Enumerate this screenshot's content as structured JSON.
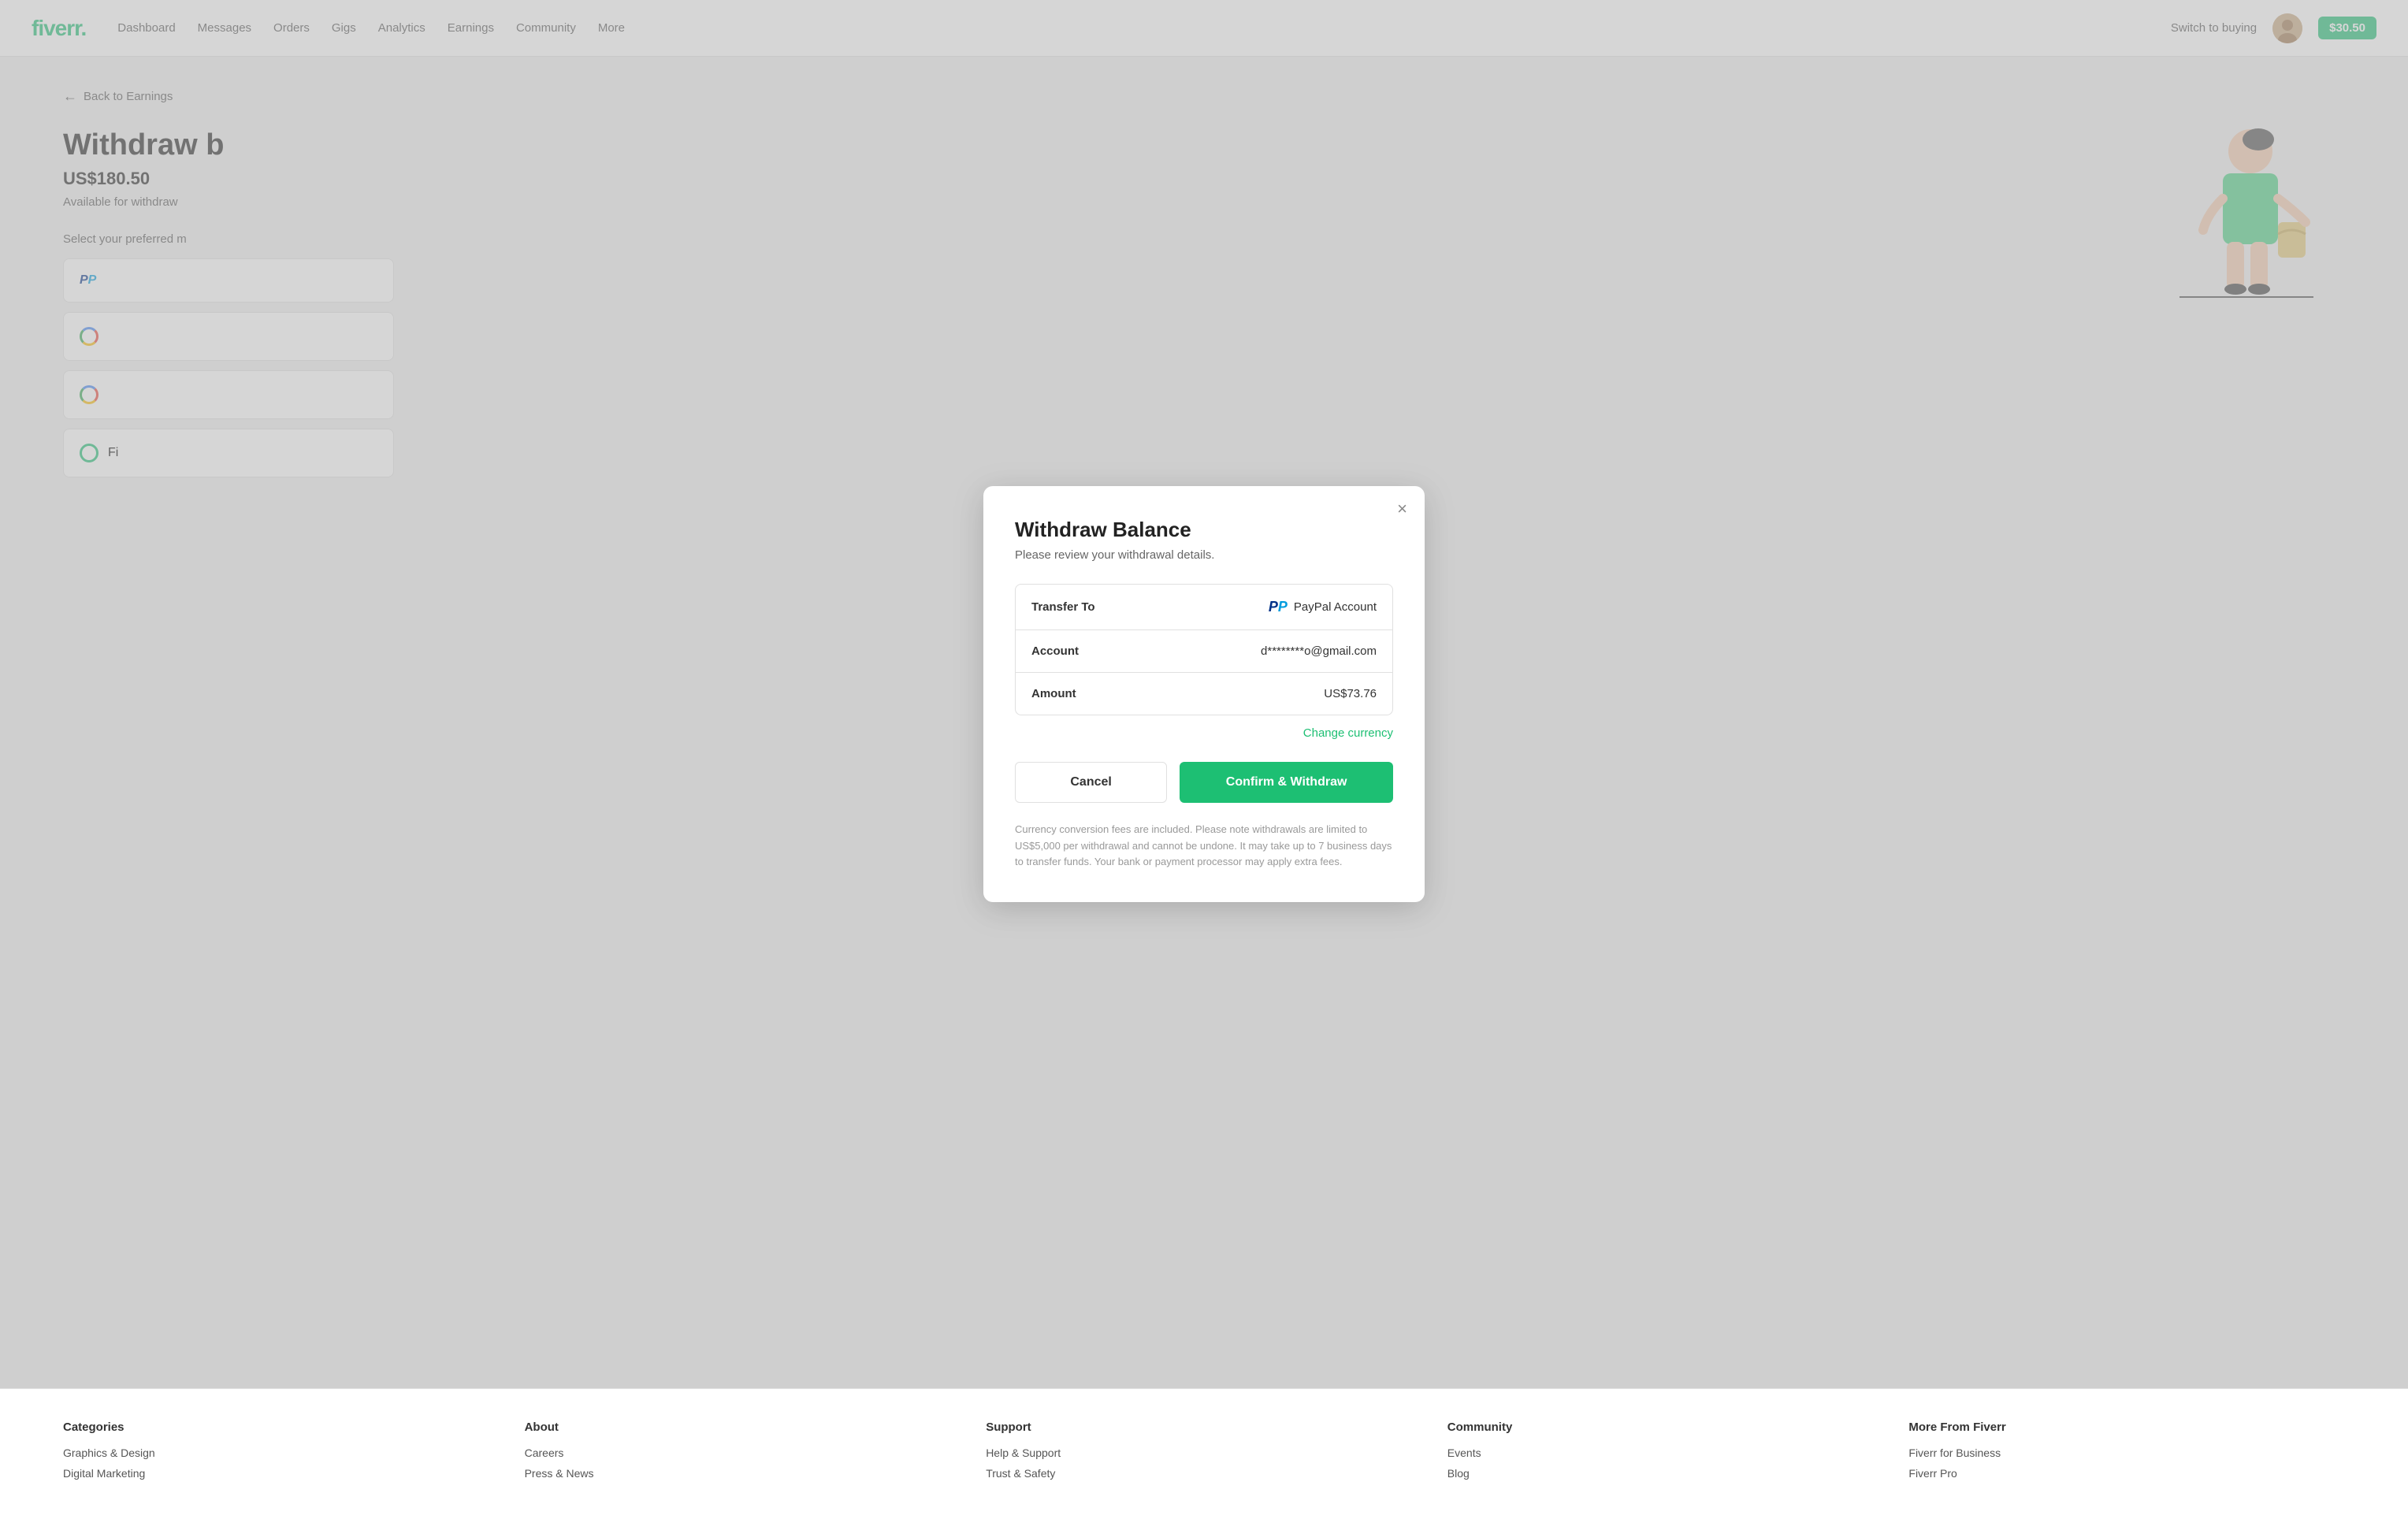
{
  "navbar": {
    "logo": "fiverr.",
    "nav_items": [
      "Dashboard",
      "Messages",
      "Orders",
      "Gigs",
      "Analytics",
      "Earnings",
      "Community",
      "More"
    ],
    "switch_buying": "Switch to buying",
    "balance": "$30.50"
  },
  "page": {
    "back_link": "Back to Earnings",
    "title": "Withdraw b",
    "available_label": "Available for withdraw",
    "amount": "US$180.50",
    "select_label": "Select your preferred m"
  },
  "modal": {
    "title": "Withdraw Balance",
    "subtitle": "Please review your withdrawal details.",
    "close_label": "×",
    "details": {
      "transfer_to_label": "Transfer To",
      "transfer_to_value": "PayPal Account",
      "account_label": "Account",
      "account_value": "d********o@gmail.com",
      "amount_label": "Amount",
      "amount_value": "US$73.76"
    },
    "change_currency": "Change currency",
    "cancel_label": "Cancel",
    "confirm_label": "Confirm & Withdraw",
    "disclaimer": "Currency conversion fees are included. Please note withdrawals are limited to US$5,000 per withdrawal and cannot be undone. It may take up to 7 business days to transfer funds. Your bank or payment processor may apply extra fees."
  },
  "footer": {
    "categories": {
      "heading": "Categories",
      "links": [
        "Graphics & Design",
        "Digital Marketing"
      ]
    },
    "about": {
      "heading": "About",
      "links": [
        "Careers",
        "Press & News"
      ]
    },
    "support": {
      "heading": "Support",
      "links": [
        "Help & Support",
        "Trust & Safety"
      ]
    },
    "community": {
      "heading": "Community",
      "links": [
        "Events",
        "Blog"
      ]
    },
    "more": {
      "heading": "More From Fiverr",
      "links": [
        "Fiverr for Business",
        "Fiverr Pro"
      ]
    }
  }
}
